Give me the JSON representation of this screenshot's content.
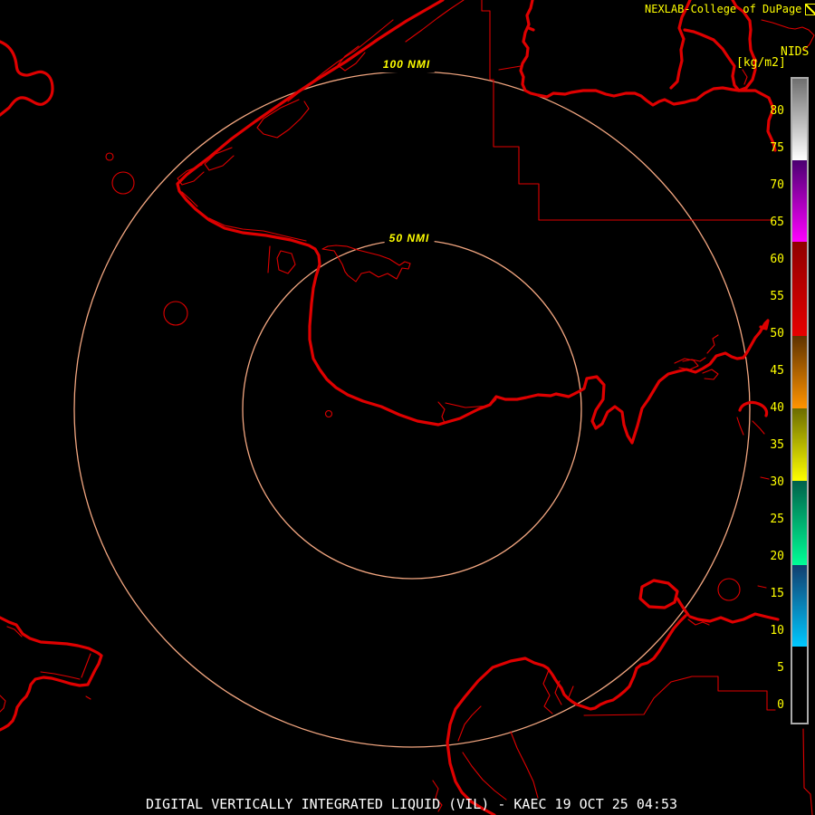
{
  "header": {
    "title": "NEXLAB-College of DuPage",
    "logo_icon": "squared-diagonal-glyph"
  },
  "colorbar": {
    "title": "NIDS",
    "units": "[kg/m2]",
    "tick_values": [
      80,
      75,
      70,
      65,
      60,
      55,
      50,
      45,
      40,
      35,
      30,
      25,
      20,
      15,
      10,
      5,
      0
    ],
    "segments": [
      {
        "name": "gray-white",
        "from": "#6f6f6f",
        "to": "#ffffff",
        "height": 90
      },
      {
        "name": "purple-magenta",
        "from": "#4a0070",
        "to": "#ff00ff",
        "height": 90
      },
      {
        "name": "darkred-red",
        "from": "#8f0000",
        "to": "#e60000",
        "height": 104
      },
      {
        "name": "brown-orange",
        "from": "#5e3200",
        "to": "#ff9400",
        "height": 80
      },
      {
        "name": "olive-yellow",
        "from": "#6b6b00",
        "to": "#ffff00",
        "height": 80
      },
      {
        "name": "teal-green",
        "from": "#00604a",
        "to": "#00ff96",
        "height": 93
      },
      {
        "name": "navy-cyan",
        "from": "#123e6e",
        "to": "#00c8ff",
        "height": 90
      },
      {
        "name": "black",
        "from": "#000000",
        "to": "#000000",
        "height": 84
      }
    ]
  },
  "rings": {
    "outer_label": "100 NMI",
    "inner_label": "50 NMI"
  },
  "footer": {
    "title": "DIGITAL VERTICALLY INTEGRATED LIQUID (VIL) - KAEC 19 OCT 25 04:53"
  },
  "colors": {
    "background": "#000000",
    "map-line": "#df0000",
    "ring": "#f2a680",
    "label-yellow": "#ffff00",
    "text-white": "#ffffff",
    "bar-border": "#aaaaaa"
  }
}
